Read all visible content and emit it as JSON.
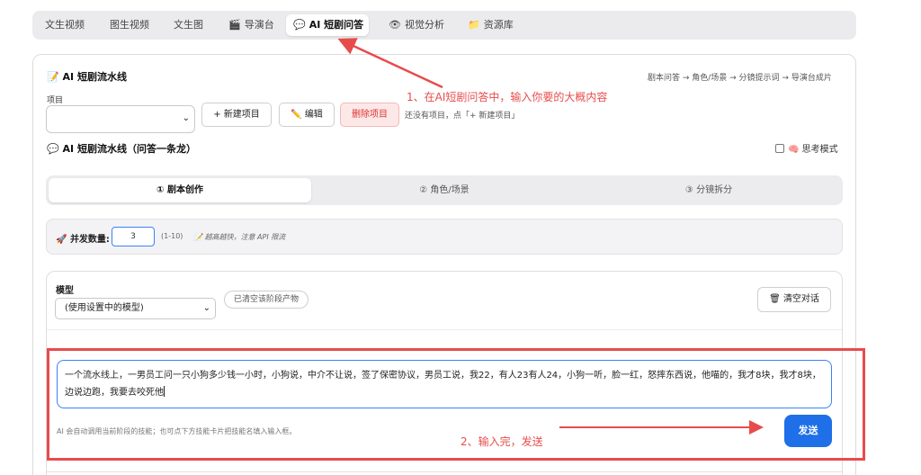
{
  "tabs": [
    {
      "label": "文生视频",
      "icon": ""
    },
    {
      "label": "图生视频",
      "icon": ""
    },
    {
      "label": "文生图",
      "icon": ""
    },
    {
      "label": "导演台",
      "icon": "clapper-icon"
    },
    {
      "label": "AI 短剧问答",
      "icon": "chat-icon",
      "active": true
    },
    {
      "label": "视觉分析",
      "icon": "eye-icon"
    },
    {
      "label": "资源库",
      "icon": "folder-icon"
    }
  ],
  "pipeline": {
    "title": "AI 短剧流水线",
    "breadcrumb": "剧本问答 → 角色/场景 → 分镜提示词 → 导演台成片",
    "project_label": "项目",
    "project_value": "",
    "new_project": "+ 新建项目",
    "edit": "编辑",
    "delete_project": "删除项目",
    "hint": "还没有项目，点「+ 新建项目」"
  },
  "qa": {
    "title": "AI 短剧流水线（问答一条龙）",
    "think_mode": "思考模式"
  },
  "steps": [
    {
      "label": "① 剧本创作",
      "active": true
    },
    {
      "label": "② 角色/场景"
    },
    {
      "label": "③ 分镜拆分"
    }
  ],
  "concurrency": {
    "label": "并发数量:",
    "value": "3",
    "range": "(1-10)",
    "note": "越高越快，注意 API 限流"
  },
  "model": {
    "label": "模型",
    "selected": "(使用设置中的模型)",
    "cleared_pill": "已清空该阶段产物",
    "clear_chat": "清空对话"
  },
  "prompt": {
    "text": "一个流水线上，一男员工问一只小狗多少钱一小时，小狗说，中介不让说，签了保密协议，男员工说，我22，有人23有人24，小狗一听，脸一红，怒摔东西说，他喵的，我才8块，我才8块，边说边跑，我要去咬死他",
    "footnote": "AI 会自动调用当前阶段的技能；也可点下方技能卡片把技能名填入输入框。",
    "send": "发送"
  },
  "annotations": {
    "step1": "1、在AI短剧问答中，输入你要的大概内容",
    "step2": "2、输入完，发送",
    "color": "#e74c4c"
  },
  "colors": {
    "accent": "#1e6fe8",
    "danger_bg": "#fde8e8",
    "danger_text": "#d33"
  }
}
